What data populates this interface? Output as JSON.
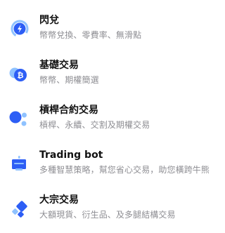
{
  "menu": {
    "items": [
      {
        "icon": "lightning-icon",
        "title": "閃兌",
        "subtitle": "幣幣兌換、零費率、無滑點"
      },
      {
        "icon": "bitcoin-coin-icon",
        "title": "基礎交易",
        "subtitle": "幣幣、期權簡選"
      },
      {
        "icon": "dots-cluster-icon",
        "title": "槓桿合約交易",
        "subtitle": "槓桿、永續、交割及期權交易"
      },
      {
        "icon": "robot-icon",
        "title": "Trading bot",
        "subtitle": "多種智慧策略，幫您省心交易，助您橫跨牛熊"
      },
      {
        "icon": "diamond-blocks-icon",
        "title": "大宗交易",
        "subtitle": "大額現貨、衍生品、及多腿結構交易"
      }
    ]
  },
  "colors": {
    "accent_blue": "#2d5ef5",
    "light_blue": "#8fc2ff",
    "title": "#121212",
    "subtitle": "#8e8e93"
  }
}
